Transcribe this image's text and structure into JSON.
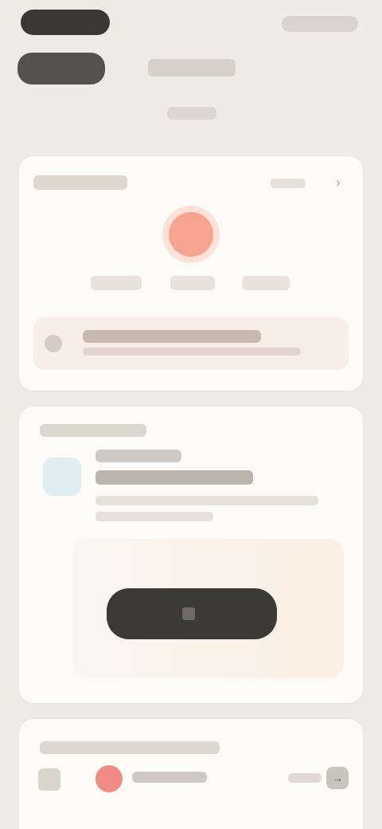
{
  "top_bar": {
    "left_pill": "",
    "right_pill": ""
  },
  "header": {
    "logo": "",
    "title": "",
    "subtitle": ""
  },
  "card_1": {
    "title": "",
    "link": "",
    "stats": [
      "",
      "",
      ""
    ],
    "alert": {
      "text": "",
      "subtext": ""
    }
  },
  "card_2": {
    "title": "",
    "heading_1": "",
    "heading_2": "",
    "description_1": "",
    "description_2": "",
    "cta_label": ""
  },
  "card_3": {
    "title": "",
    "name": "",
    "more": ""
  },
  "icons": {
    "chevron": "›",
    "arrow": "→"
  },
  "colors": {
    "background": "#efece6",
    "card": "#fcfbf8",
    "accent": "#f6a48f",
    "cta": "#3c3a36"
  }
}
